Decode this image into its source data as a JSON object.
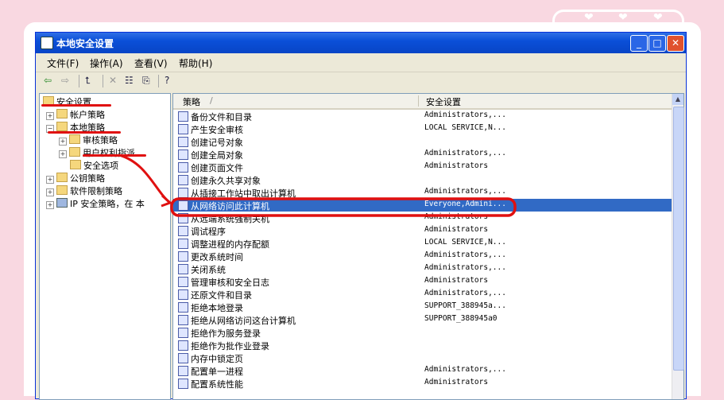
{
  "window": {
    "title": "本地安全设置"
  },
  "menu": [
    {
      "label": "文件(F)"
    },
    {
      "label": "操作(A)"
    },
    {
      "label": "查看(V)"
    },
    {
      "label": "帮助(H)"
    }
  ],
  "toolbar": {
    "back": "⇦",
    "forward": "⇨",
    "up": "⮤",
    "delete": "✕",
    "properties": "☷",
    "export": "⎘",
    "help": "?"
  },
  "tree": {
    "root": "安全设置",
    "account_policy": "帐户策略",
    "local_policy": "本地策略",
    "audit_policy": "审核策略",
    "user_rights": "用户权利指派",
    "security_options": "安全选项",
    "public_key": "公钥策略",
    "software_restriction": "软件限制策略",
    "ip_security": "IP 安全策略，在 本"
  },
  "list": {
    "col_policy": "策略",
    "col_sort": "/",
    "col_setting": "安全设置",
    "rows": [
      {
        "policy": "备份文件和目录",
        "setting": "Administrators,..."
      },
      {
        "policy": "产生安全审核",
        "setting": "LOCAL SERVICE,N..."
      },
      {
        "policy": "创建记号对象",
        "setting": ""
      },
      {
        "policy": "创建全局对象",
        "setting": "Administrators,..."
      },
      {
        "policy": "创建页面文件",
        "setting": "Administrators"
      },
      {
        "policy": "创建永久共享对象",
        "setting": ""
      },
      {
        "policy": "从插接工作站中取出计算机",
        "setting": "Administrators,..."
      },
      {
        "policy": "从网络访问此计算机",
        "setting": "Everyone,Admini..."
      },
      {
        "policy": "从远端系统强制关机",
        "setting": "Administrators"
      },
      {
        "policy": "调试程序",
        "setting": "Administrators"
      },
      {
        "policy": "调整进程的内存配额",
        "setting": "LOCAL SERVICE,N..."
      },
      {
        "policy": "更改系统时间",
        "setting": "Administrators,..."
      },
      {
        "policy": "关闭系统",
        "setting": "Administrators,..."
      },
      {
        "policy": "管理审核和安全日志",
        "setting": "Administrators"
      },
      {
        "policy": "还原文件和目录",
        "setting": "Administrators,..."
      },
      {
        "policy": "拒绝本地登录",
        "setting": "SUPPORT_388945a..."
      },
      {
        "policy": "拒绝从网络访问这台计算机",
        "setting": "SUPPORT_388945a0"
      },
      {
        "policy": "拒绝作为服务登录",
        "setting": ""
      },
      {
        "policy": "拒绝作为批作业登录",
        "setting": ""
      },
      {
        "policy": "内存中锁定页",
        "setting": ""
      },
      {
        "policy": "配置单一进程",
        "setting": "Administrators,..."
      },
      {
        "policy": "配置系统性能",
        "setting": "Administrators"
      }
    ]
  },
  "colors": {
    "titlebar": "#0a4fd8",
    "selection": "#316ac5",
    "annotation": "#e01010",
    "background": "#f9d8e1"
  }
}
